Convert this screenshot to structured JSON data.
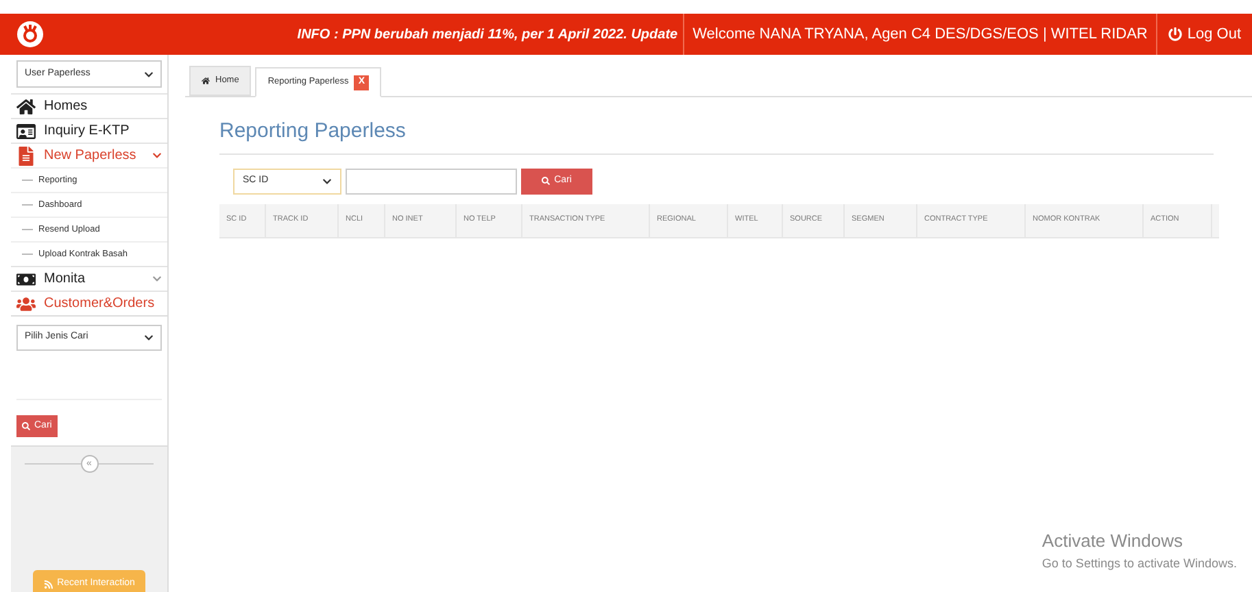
{
  "header": {
    "info_label": "INFO :",
    "info_text": "PPN berubah menjadi 11%, per 1 April 2022. Update",
    "welcome": "Welcome NANA TRYANA, Agen C4 DES/DGS/EOS | WITEL RIDAR",
    "logout": "Log Out"
  },
  "sidebar": {
    "role_select": "User Paperless",
    "items": [
      {
        "label": "Homes",
        "kind": "link",
        "active": false
      },
      {
        "label": "Inquiry E-KTP",
        "kind": "link",
        "active": false
      },
      {
        "label": "New Paperless",
        "kind": "group",
        "active": true,
        "expanded": true,
        "children": [
          {
            "label": "Reporting"
          },
          {
            "label": "Dashboard"
          },
          {
            "label": "Resend Upload"
          },
          {
            "label": "Upload Kontrak Basah"
          }
        ]
      },
      {
        "label": "Monita",
        "kind": "group",
        "active": false,
        "expanded": false
      },
      {
        "label": "Customer&Orders",
        "kind": "group",
        "active": true,
        "expanded": false
      }
    ],
    "search_select": "Pilih Jenis Cari",
    "search_button": "Cari",
    "collapse": "«",
    "recent_button": "Recent Interaction"
  },
  "tabs": [
    {
      "label": "Home",
      "selected": false
    },
    {
      "label": "Reporting Paperless",
      "selected": true,
      "close": "X"
    }
  ],
  "page": {
    "title": "Reporting Paperless",
    "filter_select": "SC ID",
    "search_button": "Cari"
  },
  "table": {
    "columns": [
      "SC ID",
      "TRACK ID",
      "NCLI",
      "NO INET",
      "NO TELP",
      "TRANSACTION TYPE",
      "REGIONAL",
      "WITEL",
      "SOURCE",
      "SEGMEN",
      "CONTRACT TYPE",
      "NOMOR KONTRAK",
      "ACTION"
    ]
  },
  "os_notice": {
    "title": "Activate Windows",
    "text": "Go to Settings to activate Windows."
  }
}
